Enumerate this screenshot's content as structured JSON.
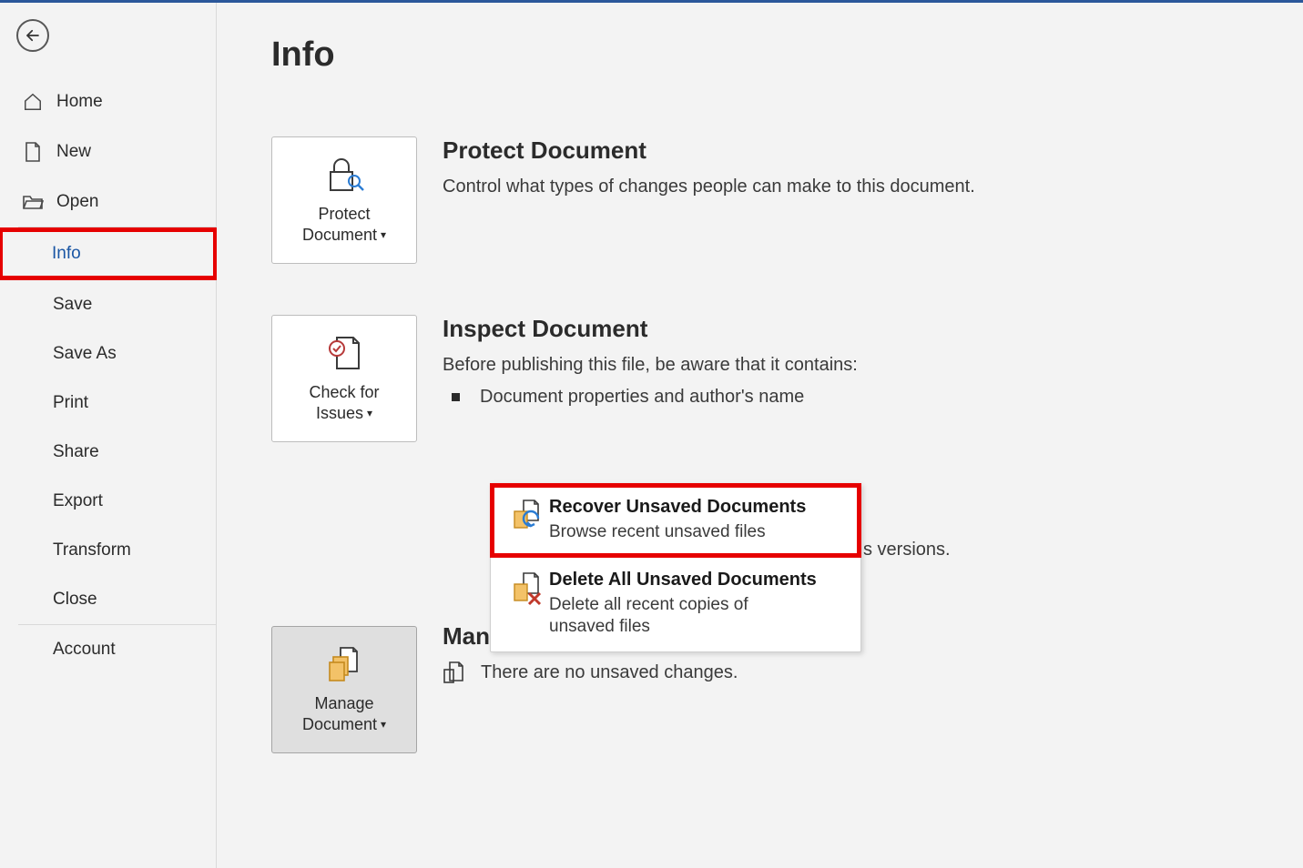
{
  "page": {
    "title": "Info"
  },
  "nav": {
    "home": "Home",
    "new": "New",
    "open": "Open",
    "info": "Info",
    "save": "Save",
    "saveas": "Save As",
    "print": "Print",
    "share": "Share",
    "export": "Export",
    "transform": "Transform",
    "close": "Close",
    "account": "Account"
  },
  "protect": {
    "button1": "Protect",
    "button2": "Document",
    "title": "Protect Document",
    "desc": "Control what types of changes people can make to this document."
  },
  "inspect": {
    "button1": "Check for",
    "button2": "Issues",
    "title": "Inspect Document",
    "desc": "Before publishing this file, be aware that it contains:",
    "bullet1": "Document properties and author's name"
  },
  "behind_fragment": "s versions.",
  "manage": {
    "button1": "Manage",
    "button2": "Document",
    "title": "Manage Document",
    "desc": "There are no unsaved changes."
  },
  "popup": {
    "recover": {
      "title": "Recover Unsaved Documents",
      "desc": "Browse recent unsaved files"
    },
    "delete": {
      "title": "Delete All Unsaved Documents",
      "desc": "Delete all recent copies of unsaved files"
    }
  }
}
